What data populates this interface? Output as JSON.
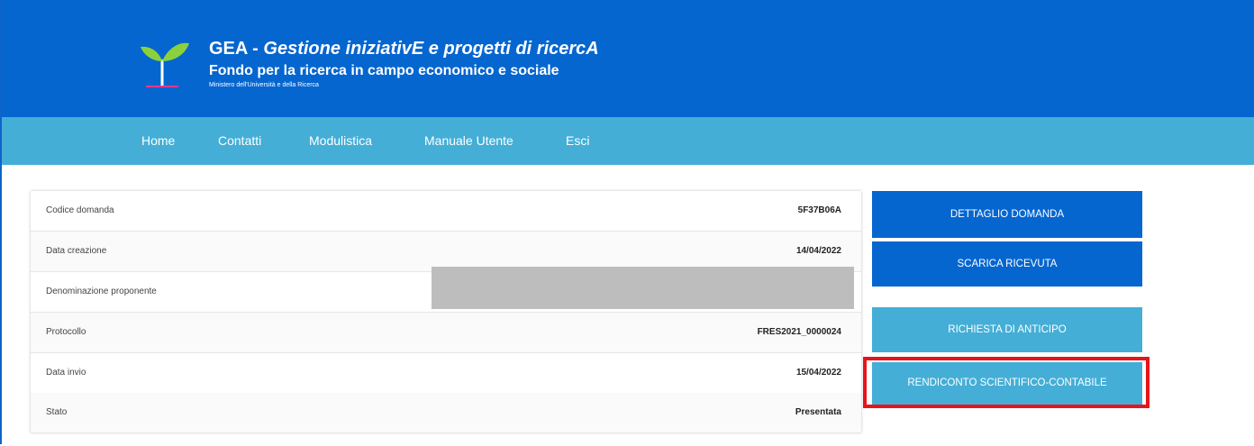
{
  "header": {
    "acronym": "GEA",
    "separator": "-",
    "full_name": "Gestione iniziativE e progetti di ricercA",
    "subtitle": "Fondo per la ricerca in campo economico e sociale",
    "ministry": "Ministero dell'Università e della Ricerca",
    "logo_icon": "sprout-logo-icon"
  },
  "nav": {
    "items": [
      {
        "label": "Home"
      },
      {
        "label": "Contatti"
      },
      {
        "label": "Modulistica"
      },
      {
        "label": "Manuale Utente"
      },
      {
        "label": "Esci"
      }
    ]
  },
  "details": {
    "rows": [
      {
        "label": "Codice domanda",
        "value": "5F37B06A"
      },
      {
        "label": "Data creazione",
        "value": "14/04/2022"
      },
      {
        "label": "Denominazione proponente",
        "value": ""
      },
      {
        "label": "Protocollo",
        "value": "FRES2021_0000024"
      },
      {
        "label": "Data invio",
        "value": "15/04/2022"
      },
      {
        "label": "Stato",
        "value": "Presentata"
      }
    ]
  },
  "actions": {
    "dettaglio": "DETTAGLIO DOMANDA",
    "scarica": "SCARICA RICEVUTA",
    "anticipo": "RICHIESTA DI ANTICIPO",
    "rendiconto": "RENDICONTO SCIENTIFICO-CONTABILE"
  },
  "colors": {
    "header_blue": "#0566d0",
    "nav_light_blue": "#44aed6",
    "highlight_red": "#e8141b"
  }
}
